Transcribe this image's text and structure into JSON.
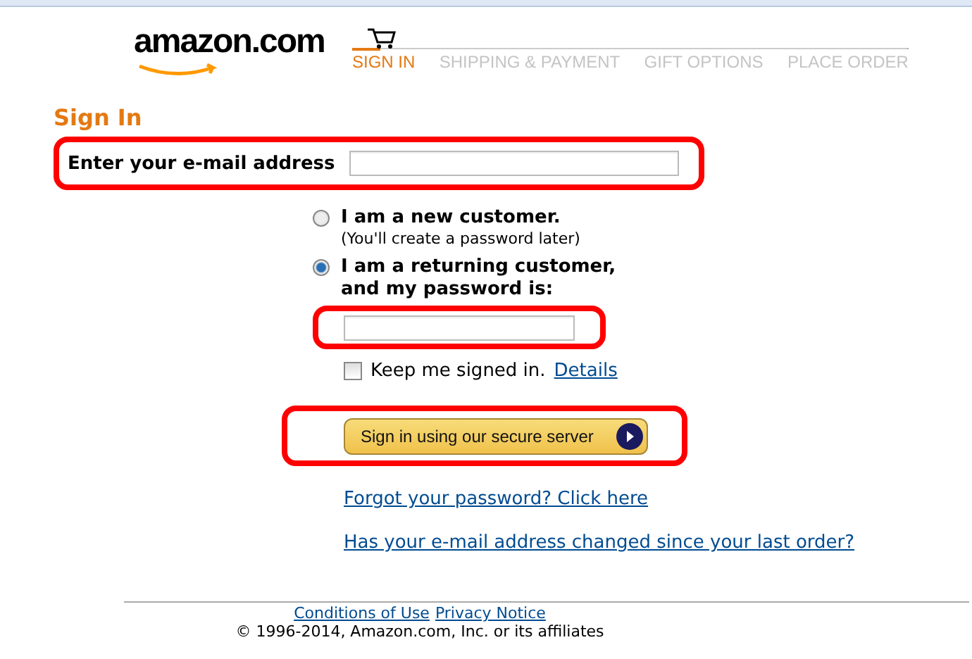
{
  "header": {
    "logo": "amazon.com",
    "steps": [
      {
        "label": "SIGN IN",
        "selected": true
      },
      {
        "label": "SHIPPING & PAYMENT",
        "selected": false
      },
      {
        "label": "GIFT OPTIONS",
        "selected": false
      },
      {
        "label": "PLACE ORDER",
        "selected": false
      }
    ]
  },
  "sign_in": {
    "title": "Sign In",
    "email_label": "Enter your e-mail address",
    "options": [
      {
        "label": "I am a new customer.",
        "note": "(You'll create a password later)",
        "selected": false
      },
      {
        "label": "I am a returning customer, and my password is:",
        "selected": true
      }
    ],
    "keep_signed_in": {
      "label": "Keep me signed in.",
      "link": "Details",
      "checked": false
    },
    "submit": "Sign in using our secure server",
    "links": [
      "Forgot your password? Click here",
      "Has your e-mail address changed since your last order?"
    ]
  },
  "footer": {
    "links": [
      "Conditions of Use",
      "Privacy Notice"
    ],
    "copyright": "© 1996-2014, Amazon.com, Inc. or its affiliates"
  }
}
